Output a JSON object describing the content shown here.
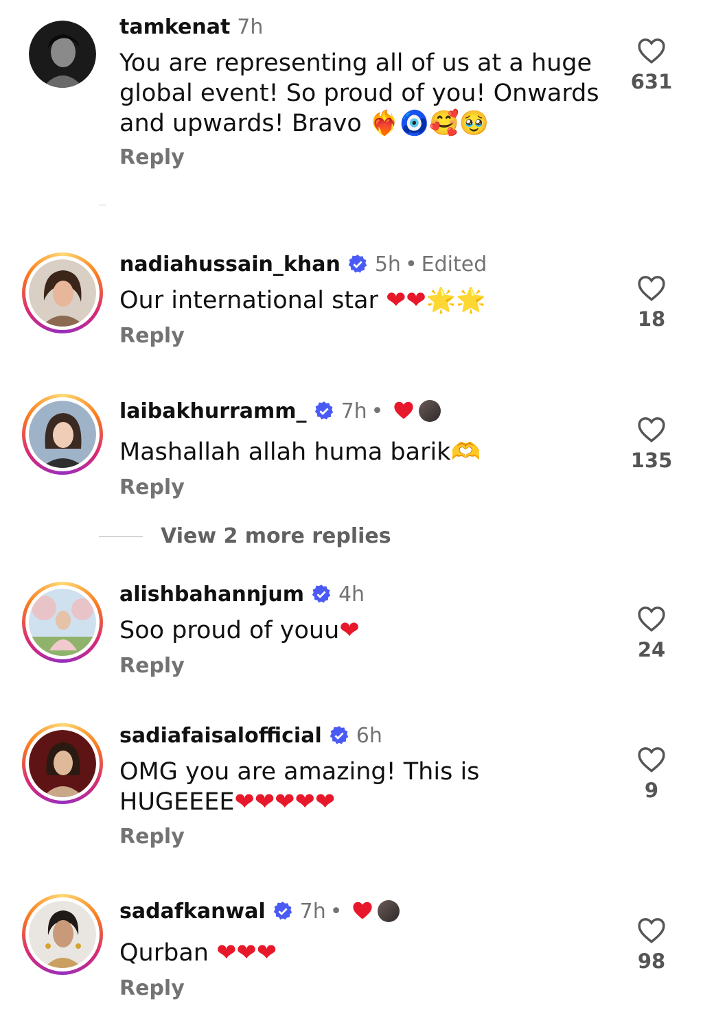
{
  "comments": [
    {
      "username": "tamkenat",
      "time": "7h",
      "verified": false,
      "edited": "",
      "text": "You are representing all of us at a huge global event! So proud of you! Onwards and upwards! Bravo",
      "emoji_text": "❤‍🔥🧿🥰🥹",
      "reply": "Reply",
      "likes": "631"
    },
    {
      "username": "nadiahussain_khan",
      "time": "5h",
      "verified": true,
      "edited": "Edited",
      "text": "Our international star ",
      "emoji_text": "❤❤🌟🌟",
      "reply": "Reply",
      "likes": "18"
    },
    {
      "username": "laibakhurramm_",
      "time": "7h",
      "verified": true,
      "edited": "",
      "creator_liked": true,
      "text": "Mashallah allah huma barik",
      "emoji_text": "🫶",
      "reply": "Reply",
      "likes": "135"
    },
    {
      "username": "alishbahannjum",
      "time": "4h",
      "verified": true,
      "edited": "",
      "text": "Soo proud of youu",
      "emoji_text": "❤",
      "reply": "Reply",
      "likes": "24"
    },
    {
      "username": "sadiafaisalofficial",
      "time": "6h",
      "verified": true,
      "edited": "",
      "text": "OMG you are amazing! This is HUGEEEE",
      "emoji_text": "❤❤❤❤❤",
      "reply": "Reply",
      "likes": "9"
    },
    {
      "username": "sadafkanwal",
      "time": "7h",
      "verified": true,
      "edited": "",
      "creator_liked": true,
      "text": "Qurban ",
      "emoji_text": "❤❤❤",
      "reply": "Reply",
      "likes": "98"
    }
  ],
  "view_more_replies": "View 2 more replies",
  "colors": {
    "verified": "#4a5bf5",
    "meta_gray": "#737373",
    "heart_red": "#e8182b"
  },
  "icons": {
    "like": "heart-outline-icon",
    "verified": "verified-badge-icon"
  }
}
